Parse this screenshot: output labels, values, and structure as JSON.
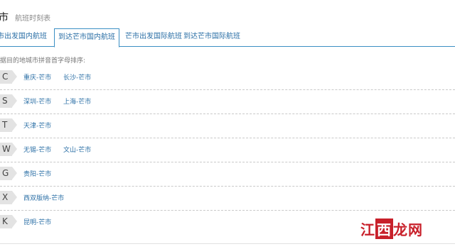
{
  "header": {
    "city": "市",
    "subtitle": "航班时刻表"
  },
  "tabs": [
    {
      "label": "市出发国内航班"
    },
    {
      "label": "到达芒市国内航班"
    },
    {
      "label": "芒市出发国际航班"
    },
    {
      "label": "到达芒市国际航班"
    }
  ],
  "hint": "据目的地城市拼音首字母排序:",
  "groups": [
    {
      "letter": "C",
      "routes": [
        "重庆-芒市",
        "长沙-芒市"
      ]
    },
    {
      "letter": "S",
      "routes": [
        "深圳-芒市",
        "上海-芒市"
      ]
    },
    {
      "letter": "T",
      "routes": [
        "天津-芒市"
      ]
    },
    {
      "letter": "W",
      "routes": [
        "无锡-芒市",
        "文山-芒市"
      ]
    },
    {
      "letter": "G",
      "routes": [
        "贵阳-芒市"
      ]
    },
    {
      "letter": "X",
      "routes": [
        "西双版纳-芒市"
      ]
    },
    {
      "letter": "K",
      "routes": [
        "昆明-芒市"
      ]
    }
  ],
  "watermark": {
    "part1": "江",
    "part2": "西",
    "part3": "龙网"
  }
}
